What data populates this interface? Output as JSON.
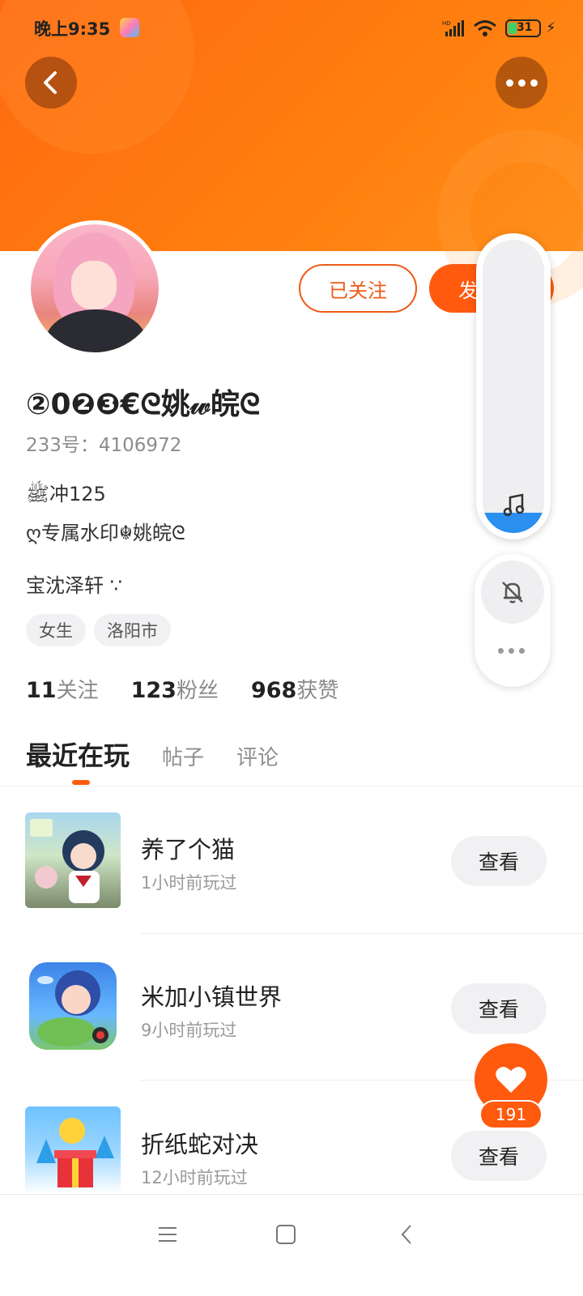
{
  "status_bar": {
    "time": "晚上9:35",
    "battery": "31",
    "network": "HD"
  },
  "profile": {
    "nickname": "②0❷❸€ᘓ姚𝓌皖ᘓ",
    "uid": "233号：4106972",
    "bio": [
      "ﷺ冲125",
      "ღ专属水印☬姚皖ᘓ",
      "宝沈泽轩 ∵"
    ],
    "tags": [
      "女生",
      "洛阳市"
    ],
    "stats": [
      {
        "value": "11",
        "label": "关注"
      },
      {
        "value": "123",
        "label": "粉丝"
      },
      {
        "value": "968",
        "label": "获赞"
      }
    ]
  },
  "actions": {
    "follow_label": "已关注",
    "message_label": "发"
  },
  "tabs": [
    {
      "label": "最近在玩",
      "active": true
    },
    {
      "label": "帖子",
      "active": false
    },
    {
      "label": "评论",
      "active": false
    }
  ],
  "games": [
    {
      "name": "养了个猫",
      "played": "1小时前玩过",
      "button": "查看"
    },
    {
      "name": "米加小镇世界",
      "played": "9小时前玩过",
      "button": "查看"
    },
    {
      "name": "折纸蛇对决",
      "played": "12小时前玩过",
      "button": "查看"
    }
  ],
  "like": {
    "count": "191"
  },
  "music_volume": 0.07,
  "colors": {
    "accent": "#ff5a0e",
    "banner": "#ff7d0e",
    "music_level": "#2b8ff0"
  },
  "icons": [
    "back-arrow-icon",
    "more-icon",
    "music-note-icon",
    "bell-off-icon",
    "heart-icon",
    "menu-icon",
    "home-icon",
    "back-icon"
  ]
}
